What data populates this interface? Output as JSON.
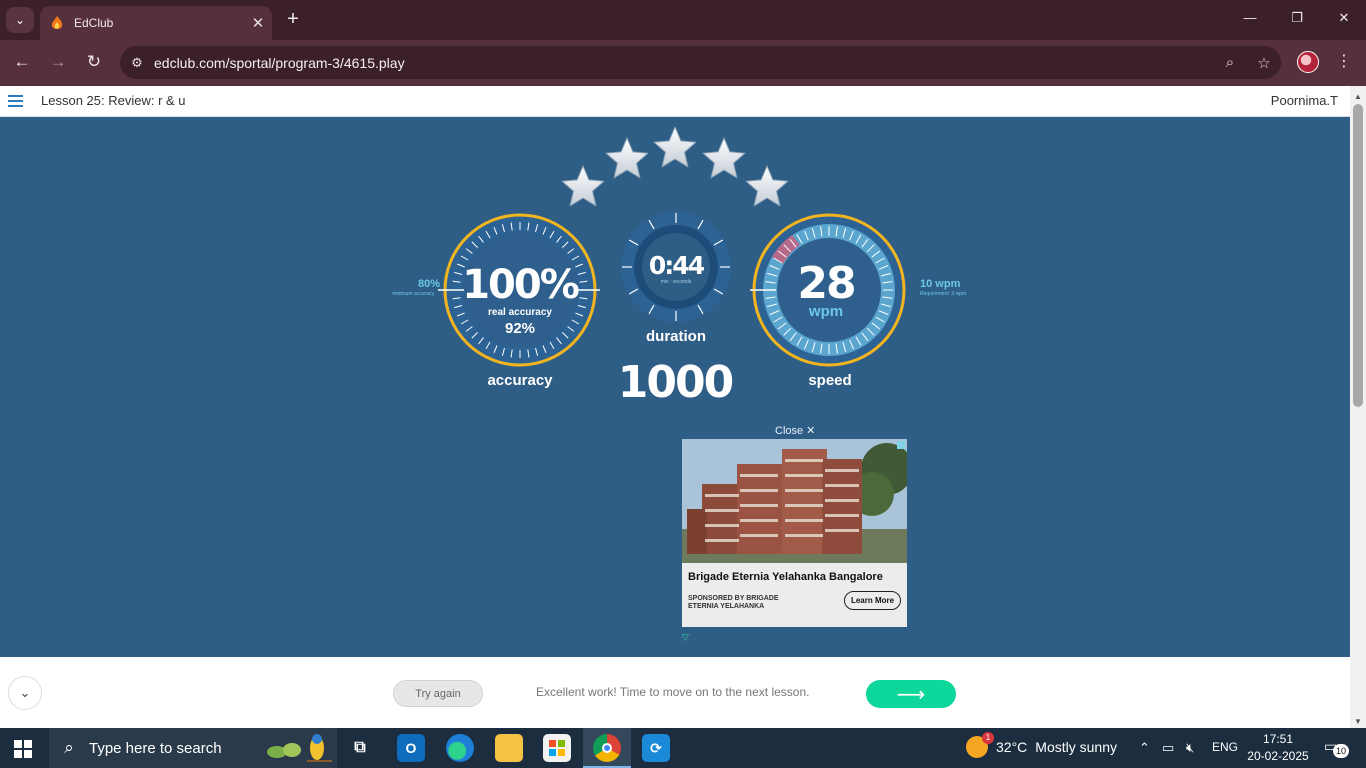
{
  "browser": {
    "tab_dropdown_icon": "chevron-down",
    "tab_title": "EdClub",
    "tab_close": "✕",
    "new_tab": "+",
    "window_minimize": "—",
    "window_restore": "❐",
    "window_close": "✕",
    "url": "edclub.com/sportal/program-3/4615.play"
  },
  "page_header": {
    "lesson_title": "Lesson 25: Review: r & u",
    "user_name": "Poornima.T"
  },
  "results": {
    "stars_earned": 5,
    "stars_total": 5,
    "accuracy": {
      "value": "100%",
      "real_label": "real accuracy",
      "real_value": "92%",
      "label": "accuracy",
      "minimum_value": "80%",
      "minimum_label": "minimum accuracy"
    },
    "duration": {
      "value": "0:44",
      "unit": "min : seconds",
      "label": "duration"
    },
    "score": "1000",
    "speed": {
      "value": "28",
      "unit": "wpm",
      "label": "speed",
      "requirement_value": "10 wpm",
      "requirement_label": "Requirement: 3 wpm"
    }
  },
  "ad": {
    "close_label": "Close ✕",
    "title": "Brigade Eternia Yelahanka Bangalore",
    "sponsor": "SPONSORED BY BRIGADE ETERNIA YELAHANKA",
    "cta": "Learn More"
  },
  "footer": {
    "try_again": "Try again",
    "message": "Excellent work! Time to move on to the next lesson.",
    "next_arrow": "⟶"
  },
  "taskbar": {
    "search_placeholder": "Type here to search",
    "weather_badge": "1",
    "weather_temp": "32°C",
    "weather_desc": "Mostly sunny",
    "language": "ENG",
    "time": "17:51",
    "date": "20-02-2025",
    "notification_count": "10"
  },
  "colors": {
    "page_bg": "#2e5d86",
    "gauge_ring_gold": "#f2b51f",
    "accent_cyan": "#6dc7ea",
    "next_button": "#0dd79a",
    "browser_frame": "#57303e"
  }
}
